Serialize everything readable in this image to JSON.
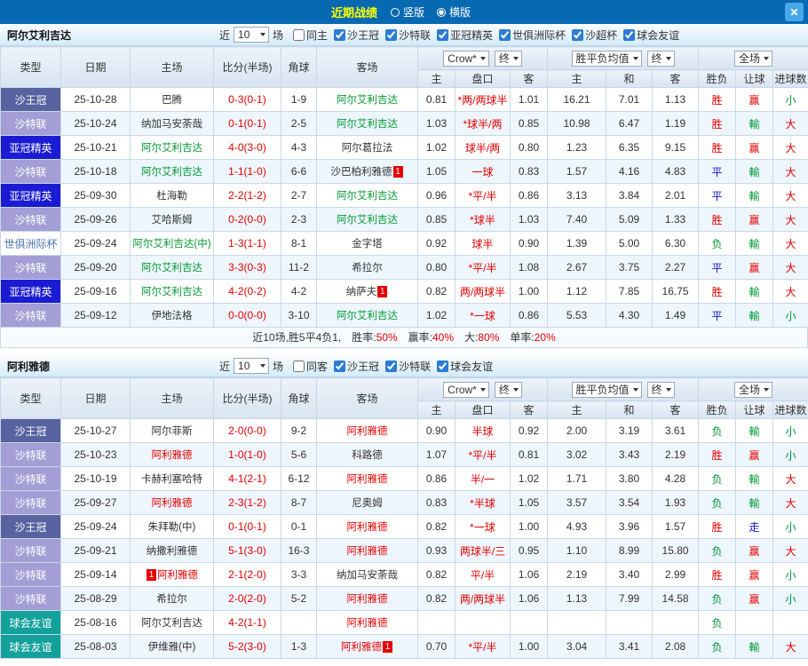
{
  "titlebar": {
    "title": "近期战绩",
    "layout_options": [
      {
        "label": "竖版",
        "selected": false
      },
      {
        "label": "横版",
        "selected": true
      }
    ],
    "close_label": "✕"
  },
  "filter": {
    "near_label": "近",
    "count": "10",
    "unit_label": "场"
  },
  "columns": {
    "h1": [
      "类型",
      "日期",
      "主场",
      "比分(半场)",
      "角球",
      "客场"
    ],
    "bookmaker": "Crow*",
    "final_label": "终",
    "avg_label": "胜平负均值",
    "scope_label": "全场",
    "h2": [
      "主",
      "盘口",
      "客",
      "主",
      "和",
      "客",
      "胜负",
      "让球",
      "进球数"
    ]
  },
  "colors": {
    "win": "#e60000",
    "draw": "#1414d2",
    "loss": "#009933",
    "team_section1": "#009933",
    "team_section2": "#e60000",
    "league_cup": "#57639f",
    "league_saudi_league": "#a49ed6",
    "league_acl_elite": "#1b1bd3",
    "league_club_friendly": "#12a19b",
    "titlebar": "#0769b1",
    "title_text": "#ffff00"
  },
  "sections": [
    {
      "team": "阿尔艾利吉达",
      "filters": [
        {
          "label": "同主",
          "checked": false
        },
        {
          "label": "沙王冠",
          "checked": true
        },
        {
          "label": "沙特联",
          "checked": true
        },
        {
          "label": "亚冠精英",
          "checked": true
        },
        {
          "label": "世俱洲际杯",
          "checked": true
        },
        {
          "label": "沙超杯",
          "checked": true
        },
        {
          "label": "球会友谊",
          "checked": true
        }
      ],
      "rows": [
        {
          "lg": "沙王冠",
          "lc": "cup",
          "d": "25-10-28",
          "h": "巴腾",
          "s": "0-3(0-1)",
          "cn": "1-9",
          "a": "阿尔艾利吉达",
          "ac": "g",
          "o": [
            "0.81",
            "*两/两球半",
            "1.01"
          ],
          "v": [
            "16.21",
            "7.01",
            "1.13"
          ],
          "r": [
            "胜",
            "r"
          ],
          "hr": [
            "赢",
            "r"
          ],
          "g": [
            "小",
            "g"
          ]
        },
        {
          "lg": "沙特联",
          "lc": "lea",
          "d": "25-10-24",
          "h": "纳加马安荼哉",
          "s": "0-1(0-1)",
          "cn": "2-5",
          "a": "阿尔艾利吉达",
          "ac": "g",
          "o": [
            "1.03",
            "*球半/两",
            "0.85"
          ],
          "v": [
            "10.98",
            "6.47",
            "1.19"
          ],
          "r": [
            "胜",
            "r"
          ],
          "hr": [
            "輸",
            "g"
          ],
          "g": [
            "大",
            "r"
          ]
        },
        {
          "lg": "亚冠精英",
          "lc": "acl",
          "d": "25-10-21",
          "h": "阿尔艾利吉达",
          "hc": "g",
          "s": "4-0(3-0)",
          "cn": "4-3",
          "a": "阿尔葛拉法",
          "o": [
            "1.02",
            "球半/两",
            "0.80"
          ],
          "v": [
            "1.23",
            "6.35",
            "9.15"
          ],
          "r": [
            "胜",
            "r"
          ],
          "hr": [
            "赢",
            "r"
          ],
          "g": [
            "大",
            "r"
          ]
        },
        {
          "lg": "沙特联",
          "lc": "lea",
          "d": "25-10-18",
          "h": "阿尔艾利吉达",
          "hc": "g",
          "s": "1-1(1-0)",
          "cn": "6-6",
          "a": "沙巴柏利雅德",
          "abPost": "1",
          "o": [
            "1.05",
            "一球",
            "0.83"
          ],
          "v": [
            "1.57",
            "4.16",
            "4.83"
          ],
          "r": [
            "平",
            "b"
          ],
          "hr": [
            "輸",
            "g"
          ],
          "g": [
            "大",
            "r"
          ]
        },
        {
          "lg": "亚冠精英",
          "lc": "acl",
          "d": "25-09-30",
          "h": "杜海勒",
          "s": "2-2(1-2)",
          "cn": "2-7",
          "a": "阿尔艾利吉达",
          "ac": "g",
          "o": [
            "0.96",
            "*平/半",
            "0.86"
          ],
          "v": [
            "3.13",
            "3.84",
            "2.01"
          ],
          "r": [
            "平",
            "b"
          ],
          "hr": [
            "輸",
            "g"
          ],
          "g": [
            "大",
            "r"
          ]
        },
        {
          "lg": "沙特联",
          "lc": "lea",
          "d": "25-09-26",
          "h": "艾哈斯姆",
          "s": "0-2(0-0)",
          "cn": "2-3",
          "a": "阿尔艾利吉达",
          "ac": "g",
          "o": [
            "0.85",
            "*球半",
            "1.03"
          ],
          "v": [
            "7.40",
            "5.09",
            "1.33"
          ],
          "r": [
            "胜",
            "r"
          ],
          "hr": [
            "赢",
            "r"
          ],
          "g": [
            "大",
            "r"
          ]
        },
        {
          "lg": "世俱洲际杯",
          "lc": "wcc",
          "d": "25-09-24",
          "h": "阿尔艾利吉达(中)",
          "hc": "g",
          "s": "1-3(1-1)",
          "cn": "8-1",
          "a": "金字塔",
          "o": [
            "0.92",
            "球半",
            "0.90"
          ],
          "v": [
            "1.39",
            "5.00",
            "6.30"
          ],
          "r": [
            "负",
            "g"
          ],
          "hr": [
            "輸",
            "g"
          ],
          "g": [
            "大",
            "r"
          ]
        },
        {
          "lg": "沙特联",
          "lc": "lea",
          "d": "25-09-20",
          "h": "阿尔艾利吉达",
          "hc": "g",
          "s": "3-3(0-3)",
          "cn": "11-2",
          "a": "希拉尔",
          "o": [
            "0.80",
            "*平/半",
            "1.08"
          ],
          "v": [
            "2.67",
            "3.75",
            "2.27"
          ],
          "r": [
            "平",
            "b"
          ],
          "hr": [
            "赢",
            "r"
          ],
          "g": [
            "大",
            "r"
          ]
        },
        {
          "lg": "亚冠精英",
          "lc": "acl",
          "d": "25-09-16",
          "h": "阿尔艾利吉达",
          "hc": "g",
          "s": "4-2(0-2)",
          "cn": "4-2",
          "a": "纳萨夫",
          "abPost": "1",
          "o": [
            "0.82",
            "两/两球半",
            "1.00"
          ],
          "v": [
            "1.12",
            "7.85",
            "16.75"
          ],
          "r": [
            "胜",
            "r"
          ],
          "hr": [
            "輸",
            "g"
          ],
          "g": [
            "大",
            "r"
          ]
        },
        {
          "lg": "沙特联",
          "lc": "lea",
          "d": "25-09-12",
          "h": "伊地法格",
          "s": "0-0(0-0)",
          "cn": "3-10",
          "a": "阿尔艾利吉达",
          "ac": "g",
          "o": [
            "1.02",
            "*一球",
            "0.86"
          ],
          "v": [
            "5.53",
            "4.30",
            "1.49"
          ],
          "r": [
            "平",
            "b"
          ],
          "hr": [
            "輸",
            "g"
          ],
          "g": [
            "小",
            "g"
          ]
        }
      ],
      "summary": [
        {
          "t": "近10场,胜5平4负1,　",
          "red": false
        },
        {
          "t": "胜率:",
          "red": false
        },
        {
          "t": "50%",
          "red": true
        },
        {
          "t": "　赢率:",
          "red": false
        },
        {
          "t": "40%",
          "red": true
        },
        {
          "t": "　大:",
          "red": false
        },
        {
          "t": "80%",
          "red": true
        },
        {
          "t": "　单率:",
          "red": false
        },
        {
          "t": "20%",
          "red": true
        }
      ]
    },
    {
      "team": "阿利雅德",
      "filters": [
        {
          "label": "同客",
          "checked": false
        },
        {
          "label": "沙王冠",
          "checked": true
        },
        {
          "label": "沙特联",
          "checked": true
        },
        {
          "label": "球会友谊",
          "checked": true
        }
      ],
      "rows": [
        {
          "lg": "沙王冠",
          "lc": "cup",
          "d": "25-10-27",
          "h": "阿尔菲斯",
          "s": "2-0(0-0)",
          "cn": "9-2",
          "a": "阿利雅德",
          "ac": "r",
          "o": [
            "0.90",
            "半球",
            "0.92"
          ],
          "v": [
            "2.00",
            "3.19",
            "3.61"
          ],
          "r": [
            "负",
            "g"
          ],
          "hr": [
            "輸",
            "g"
          ],
          "g": [
            "小",
            "g"
          ]
        },
        {
          "lg": "沙特联",
          "lc": "lea",
          "d": "25-10-23",
          "h": "阿利雅德",
          "hc": "r",
          "s": "1-0(1-0)",
          "cn": "5-6",
          "a": "科路德",
          "o": [
            "1.07",
            "*平/半",
            "0.81"
          ],
          "v": [
            "3.02",
            "3.43",
            "2.19"
          ],
          "r": [
            "胜",
            "r"
          ],
          "hr": [
            "赢",
            "r"
          ],
          "g": [
            "小",
            "g"
          ]
        },
        {
          "lg": "沙特联",
          "lc": "lea",
          "d": "25-10-19",
          "h": "卡赫利塞哈特",
          "s": "4-1(2-1)",
          "cn": "6-12",
          "a": "阿利雅德",
          "ac": "r",
          "o": [
            "0.86",
            "半/一",
            "1.02"
          ],
          "v": [
            "1.71",
            "3.80",
            "4.28"
          ],
          "r": [
            "负",
            "g"
          ],
          "hr": [
            "輸",
            "g"
          ],
          "g": [
            "大",
            "r"
          ]
        },
        {
          "lg": "沙特联",
          "lc": "lea",
          "d": "25-09-27",
          "h": "阿利雅德",
          "hc": "r",
          "s": "2-3(1-2)",
          "cn": "8-7",
          "a": "尼奥姆",
          "o": [
            "0.83",
            "*半球",
            "1.05"
          ],
          "v": [
            "3.57",
            "3.54",
            "1.93"
          ],
          "r": [
            "负",
            "g"
          ],
          "hr": [
            "輸",
            "g"
          ],
          "g": [
            "大",
            "r"
          ]
        },
        {
          "lg": "沙王冠",
          "lc": "cup",
          "d": "25-09-24",
          "h": "朱拜勒(中)",
          "s": "0-1(0-1)",
          "cn": "0-1",
          "a": "阿利雅德",
          "ac": "r",
          "o": [
            "0.82",
            "*一球",
            "1.00"
          ],
          "v": [
            "4.93",
            "3.96",
            "1.57"
          ],
          "r": [
            "胜",
            "r"
          ],
          "hr": [
            "走",
            "b"
          ],
          "g": [
            "小",
            "g"
          ]
        },
        {
          "lg": "沙特联",
          "lc": "lea",
          "d": "25-09-21",
          "h": "纳撒利雅德",
          "s": "5-1(3-0)",
          "cn": "16-3",
          "a": "阿利雅德",
          "ac": "r",
          "o": [
            "0.93",
            "两球半/三",
            "0.95"
          ],
          "v": [
            "1.10",
            "8.99",
            "15.80"
          ],
          "r": [
            "负",
            "g"
          ],
          "hr": [
            "赢",
            "r"
          ],
          "g": [
            "大",
            "r"
          ]
        },
        {
          "lg": "沙特联",
          "lc": "lea",
          "d": "25-09-14",
          "h": "阿利雅德",
          "hc": "r",
          "hbPre": "1",
          "s": "2-1(2-0)",
          "cn": "3-3",
          "a": "纳加马安荼哉",
          "o": [
            "0.82",
            "平/半",
            "1.06"
          ],
          "v": [
            "2.19",
            "3.40",
            "2.99"
          ],
          "r": [
            "胜",
            "r"
          ],
          "hr": [
            "赢",
            "r"
          ],
          "g": [
            "小",
            "g"
          ]
        },
        {
          "lg": "沙特联",
          "lc": "lea",
          "d": "25-08-29",
          "h": "希拉尔",
          "s": "2-0(2-0)",
          "cn": "5-2",
          "a": "阿利雅德",
          "ac": "r",
          "o": [
            "0.82",
            "两/两球半",
            "1.06"
          ],
          "v": [
            "1.13",
            "7.99",
            "14.58"
          ],
          "r": [
            "负",
            "g"
          ],
          "hr": [
            "赢",
            "r"
          ],
          "g": [
            "小",
            "g"
          ]
        },
        {
          "lg": "球会友谊",
          "lc": "fri",
          "d": "25-08-16",
          "h": "阿尔艾利吉达",
          "s": "4-2(1-1)",
          "cn": "",
          "a": "阿利雅德",
          "ac": "r",
          "o": [
            "",
            "",
            ""
          ],
          "v": [
            "",
            "",
            ""
          ],
          "r": [
            "负",
            "g"
          ],
          "hr": [
            "",
            ""
          ],
          "g": [
            "",
            ""
          ]
        },
        {
          "lg": "球会友谊",
          "lc": "fri",
          "d": "25-08-03",
          "h": "伊维雅(中)",
          "s": "5-2(3-0)",
          "cn": "1-3",
          "a": "阿利雅德",
          "ac": "r",
          "abPost": "1",
          "o": [
            "0.70",
            "*平/半",
            "1.00"
          ],
          "v": [
            "3.04",
            "3.41",
            "2.08"
          ],
          "r": [
            "负",
            "g"
          ],
          "hr": [
            "輸",
            "g"
          ],
          "g": [
            "大",
            "r"
          ]
        }
      ],
      "summary": null
    }
  ]
}
